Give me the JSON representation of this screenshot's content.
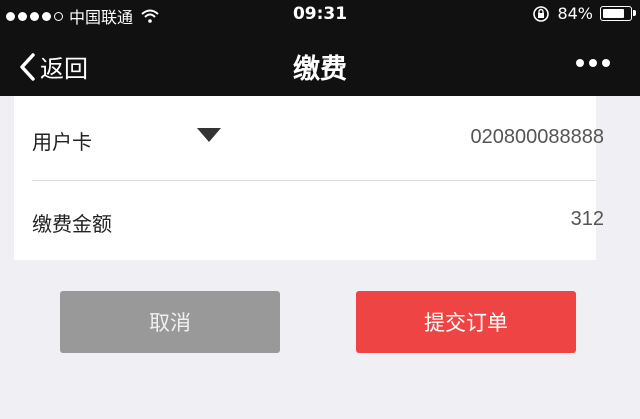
{
  "status_bar": {
    "carrier": "中国联通",
    "time": "09:31",
    "battery_percent": "84%",
    "battery_level": 0.84,
    "signal_bars_filled": 4,
    "signal_bars_total": 5
  },
  "nav": {
    "back_label": "返回",
    "title": "缴费"
  },
  "form": {
    "card_label": "用户卡",
    "card_value": "020800088888",
    "amount_label": "缴费金额",
    "amount_value": "312"
  },
  "buttons": {
    "cancel_label": "取消",
    "submit_label": "提交订单",
    "submit_color": "#ef4444",
    "cancel_color": "#999999"
  }
}
